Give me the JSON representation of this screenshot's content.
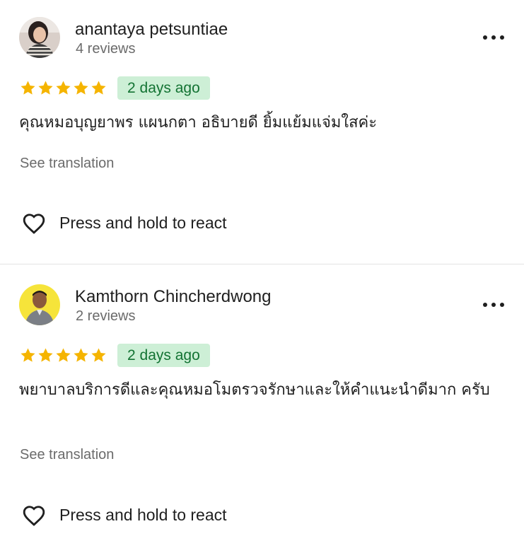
{
  "reviews": [
    {
      "reviewer_name": "anantaya petsuntiae",
      "review_count": "4 reviews",
      "rating": 5,
      "time_ago": "2 days ago",
      "text": "คุณหมอบุญยาพร แผนกตา อธิบายดี ยิ้มแย้มแจ่มใสค่ะ",
      "translate_label": "See translation",
      "react_label": "Press and hold to react"
    },
    {
      "reviewer_name": "Kamthorn Chincherdwong",
      "review_count": "2 reviews",
      "rating": 5,
      "time_ago": "2 days ago",
      "text": "พยาบาลบริการดีและคุณหมอโมตรวจรักษาและให้คำแนะนำดีมาก ครับ",
      "translate_label": "See translation",
      "react_label": "Press and hold to react"
    }
  ],
  "icons": {
    "star": "star-icon",
    "more": "more-options-icon",
    "heart": "heart-icon"
  },
  "colors": {
    "star": "#f5b400",
    "badge_bg": "#cdefd6",
    "badge_text": "#137333",
    "secondary_text": "#6b6b6b"
  }
}
